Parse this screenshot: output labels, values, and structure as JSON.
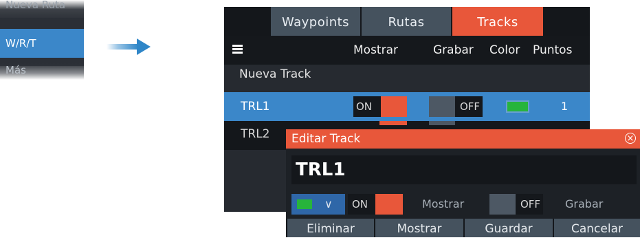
{
  "mini_menu": {
    "items": [
      "Nueva Ruta",
      "W/R/T",
      "Más"
    ],
    "selected": "W/R/T"
  },
  "tabs": [
    {
      "label": "Waypoints",
      "active": false
    },
    {
      "label": "Rutas",
      "active": false
    },
    {
      "label": "Tracks",
      "active": true
    }
  ],
  "columns": {
    "mostrar": "Mostrar",
    "grabar": "Grabar",
    "color": "Color",
    "puntos": "Puntos"
  },
  "new_track_label": "Nueva Track",
  "tracks": [
    {
      "name": "TRL1",
      "show": "ON",
      "record": "OFF",
      "color": "#27b43c",
      "points": "1",
      "selected": true
    },
    {
      "name": "TRL2",
      "selected": false
    }
  ],
  "dialog": {
    "title": "Editar Track",
    "name": "TRL1",
    "show_state": "ON",
    "show_label": "Mostrar",
    "record_state": "OFF",
    "record_label": "Grabar",
    "color": "#27b43c",
    "buttons": {
      "delete": "Eliminar",
      "show": "Mostrar",
      "save": "Guardar",
      "cancel": "Cancelar"
    }
  },
  "colors": {
    "accent": "#e8573a",
    "selection": "#3b87c9",
    "track_color": "#27b43c"
  }
}
